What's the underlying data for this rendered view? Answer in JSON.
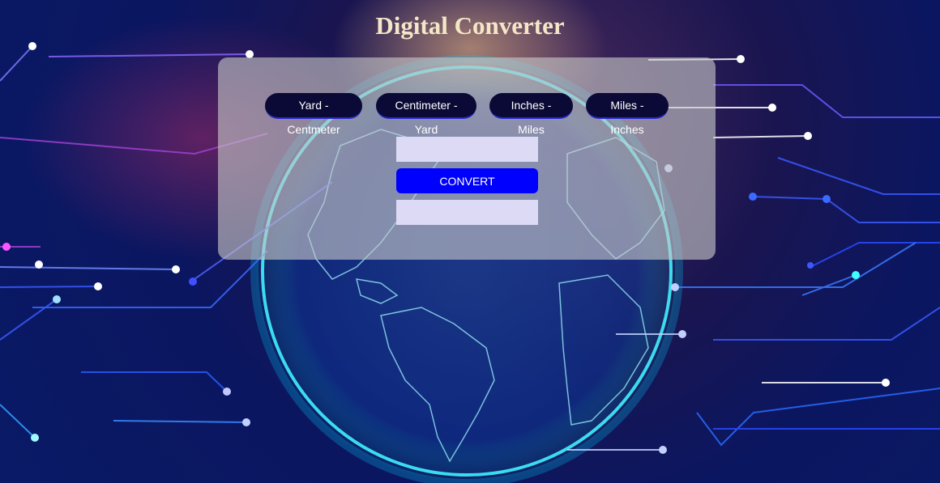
{
  "page": {
    "title": "Digital Converter"
  },
  "tabs": [
    {
      "label": "Yard - Centmeter"
    },
    {
      "label": "Centimeter - Yard"
    },
    {
      "label": "Inches - Miles"
    },
    {
      "label": "Miles - Inches"
    }
  ],
  "converter": {
    "input_value": "",
    "convert_label": "CONVERT",
    "output_value": ""
  },
  "colors": {
    "background": "#0b1660",
    "title": "#f5e6c8",
    "tab_bg": "#0b0a36",
    "field_bg": "#dcdaf5",
    "convert_bg": "#0000ff"
  },
  "icons": [
    "globe-background",
    "circuit-lines-background"
  ]
}
